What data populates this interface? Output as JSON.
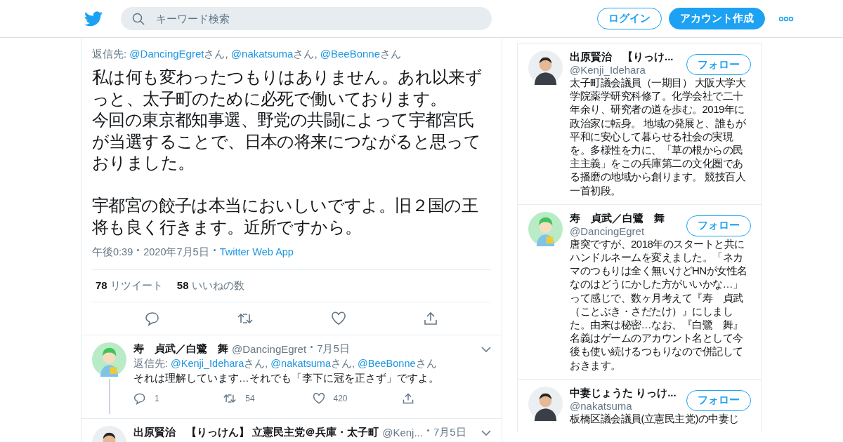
{
  "header": {
    "search_placeholder": "キーワード検索",
    "login": "ログイン",
    "signup": "アカウント作成"
  },
  "tweet": {
    "reply_label": "返信先:",
    "mentions": [
      {
        "handle": "@DancingEgret",
        "suffix": "さん, "
      },
      {
        "handle": "@nakatsuma",
        "suffix": "さん, "
      },
      {
        "handle": "@BeeBonne",
        "suffix": "さん"
      }
    ],
    "paragraphs": [
      {
        "text": "私は何も変わったつもりはありません。あれ以来ずっと、太子町のために必死で働いております。",
        "gap_after": false
      },
      {
        "text": "今回の東京都知事選、野党の共闘によって宇都宮氏が当選することで、日本の将来につながると思っておりました。",
        "gap_after": true
      },
      {
        "text": "宇都宮の餃子は本当においしいですよ。旧２国の王将も良く行きます。近所ですから。",
        "gap_after": false
      }
    ],
    "time": "午後0:39",
    "date": "2020年7月5日",
    "source": "Twitter Web App",
    "stats": [
      {
        "count": "78",
        "label": "リツイート"
      },
      {
        "count": "58",
        "label": "いいねの数"
      }
    ]
  },
  "replies": [
    {
      "name": "寿　貞武／白鷺　舞",
      "handle": "@DancingEgret",
      "date": "7月5日",
      "avatar": {
        "kind": "cartoon"
      },
      "thread_line": true,
      "reply_label": "返信先:",
      "mentions": [
        {
          "handle": "@Kenji_Idehara",
          "suffix": "さん, "
        },
        {
          "handle": "@nakatsuma",
          "suffix": "さん, "
        },
        {
          "handle": "@BeeBonne",
          "suffix": "さん"
        }
      ],
      "text": "それは理解しています…それでも「李下に冠を正さず」ですよ。",
      "replies": "1",
      "retweets": "54",
      "likes": "420"
    },
    {
      "name": "出原賢治　【りっけん】 立憲民主党＠兵庫・太子町",
      "handle": "@Kenj...",
      "date": "7月5日",
      "avatar": {
        "kind": "person"
      },
      "thread_line": false
    }
  ],
  "profiles": [
    {
      "name": "出原賢治　【りっけ...",
      "handle": "@Kenji_Idehara",
      "follow": "フォロー",
      "avatar": {
        "kind": "person"
      },
      "bio": "太子町議会議員（一期目） 大阪大学大学院薬学研究科修了。化学会社で二十年余り、研究者の道を歩む。2019年に政治家に転身。 地域の発展と、誰もが平和に安心して暮らせる社会の実現を。多様性を力に、「草の根からの民主主義」をこの兵庫第二の文化圏である播磨の地域から創ります。 競技百人一首初段。"
    },
    {
      "name": "寿　貞武／白鷺　舞",
      "handle": "@DancingEgret",
      "follow": "フォロー",
      "avatar": {
        "kind": "cartoon"
      },
      "bio": "唐突ですが、2018年のスタートと共にハンドルネームを変えました。「ネカマのつもりは全く無いけどHNが女性名なのはどうにかした方がいいかな…」って感じで、数ヶ月考えて『寿　貞武（ことぶき・さだたけ）』にしました。由来は秘密…なお、『白鷺　舞』名義はゲームのアカウント名として今後も使い続けるつもりなので併記しておきます。"
    },
    {
      "name": "中妻じょうた りっけ...",
      "handle": "@nakatsuma",
      "follow": "フォロー",
      "avatar": {
        "kind": "person"
      },
      "bio": "板橋区議会議員(立憲民主党)の中妻じ"
    }
  ]
}
